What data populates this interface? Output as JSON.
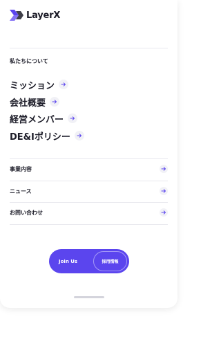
{
  "brand": {
    "name": "LayerX",
    "accent": "#5b45ee"
  },
  "about": {
    "section_label": "私たちについて",
    "links": [
      {
        "label": "ミッション",
        "icon": "arrow-right-icon"
      },
      {
        "label": "会社概要",
        "icon": "arrow-right-icon"
      },
      {
        "label": "経営メンバー",
        "icon": "arrow-right-icon"
      },
      {
        "label": "DE&Iポリシー",
        "icon": "arrow-right-icon"
      }
    ]
  },
  "nav": {
    "items": [
      {
        "label": "事業内容",
        "icon": "arrow-right-icon"
      },
      {
        "label": "ニュース",
        "icon": "arrow-right-icon"
      },
      {
        "label": "お問い合わせ",
        "icon": "arrow-right-icon"
      }
    ]
  },
  "cta": {
    "join_label": "Join Us",
    "recruit_label": "採用情報"
  }
}
